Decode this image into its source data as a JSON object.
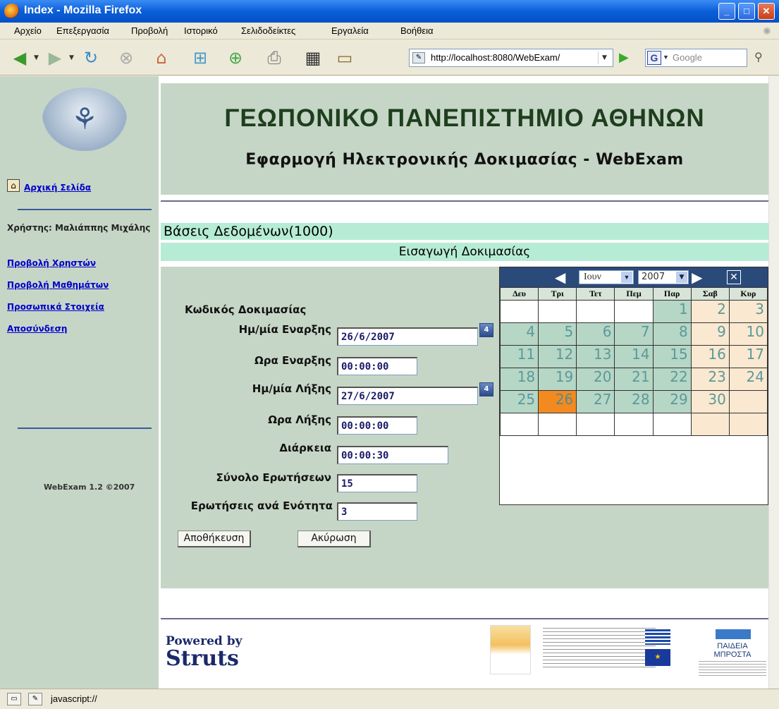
{
  "window": {
    "title": "Index - Mozilla Firefox",
    "minimize": "_",
    "maximize": "□",
    "close": "✕"
  },
  "menu": [
    "Αρχείο",
    "Επεξεργασία",
    "Προβολή",
    "Ιστορικό",
    "Σελιδοδείκτες",
    "Εργαλεία",
    "Βοήθεια"
  ],
  "toolbar": {
    "url": "http://localhost:8080/WebExam/",
    "search_placeholder": "Google",
    "search_engine": "G"
  },
  "sidebar": {
    "home_label": "Αρχική Σελίδα",
    "user_label": "Χρήστης: Μαλιάππης Μιχάλης",
    "links": [
      "Προβολή Χρηστών",
      "Προβολή Μαθημάτων",
      "Προσωπικά Στοιχεία",
      "Αποσύνδεση"
    ],
    "version": "WebExam 1.2 ©2007"
  },
  "header": {
    "university": "ΓΕΩΠΟΝΙΚΟ ΠΑΝΕΠΙΣΤΗΜΙΟ ΑΘΗΝΩΝ",
    "app": "Εφαρμογή Ηλεκτρονικής Δοκιμασίας - WebExam"
  },
  "course": "Βάσεις Δεδομένων(1000)",
  "section": "Εισαγωγή Δοκιμασίας",
  "form": {
    "code_label": "Κωδικός Δοκιμασίας",
    "start_date_label": "Ημ/μία Εναρξης",
    "start_date": "26/6/2007",
    "start_time_label": "Ωρα Εναρξης",
    "start_time": "00:00:00",
    "end_date_label": "Ημ/μία Λήξης",
    "end_date": "27/6/2007",
    "end_time_label": "Ωρα Λήξης",
    "end_time": "00:00:00",
    "duration_label": "Διάρκεια",
    "duration": "00:00:30",
    "total_questions_label": "Σύνολο Ερωτήσεων",
    "total_questions": "15",
    "per_section_label": "Ερωτήσεις ανά Ενότητα",
    "per_section": "3",
    "save_label": "Αποθήκευση",
    "cancel_label": "Ακύρωση",
    "calendar_icon_text": "4"
  },
  "calendar": {
    "month": "Ιουν",
    "year": "2007",
    "weekdays": [
      "Δευ",
      "Τρι",
      "Τετ",
      "Πεμ",
      "Παρ",
      "Σαβ",
      "Κυρ"
    ],
    "weeks": [
      [
        "",
        "",
        "",
        "",
        "1",
        "2",
        "3"
      ],
      [
        "4",
        "5",
        "6",
        "7",
        "8",
        "9",
        "10"
      ],
      [
        "11",
        "12",
        "13",
        "14",
        "15",
        "16",
        "17"
      ],
      [
        "18",
        "19",
        "20",
        "21",
        "22",
        "23",
        "24"
      ],
      [
        "25",
        "26",
        "27",
        "28",
        "29",
        "30",
        ""
      ],
      [
        "",
        "",
        "",
        "",
        "",
        "",
        ""
      ]
    ],
    "selected": "26"
  },
  "footer": {
    "powered_by": "Powered by",
    "struts": "Struts",
    "paideia": "ΠΑΙΔΕΙΑ ΜΠΡΟΣΤΑ"
  },
  "status": "javascript://"
}
